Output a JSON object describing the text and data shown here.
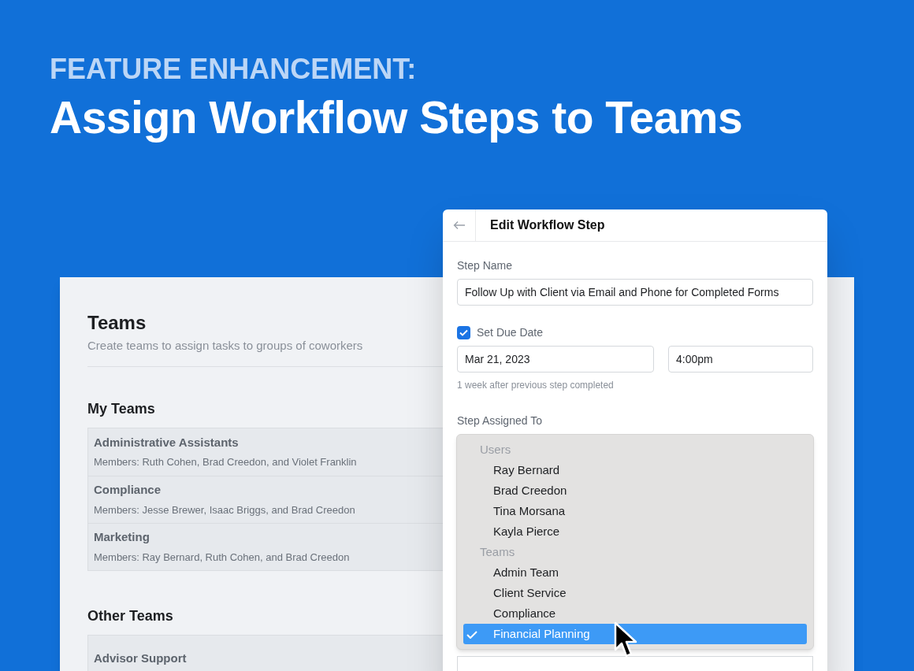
{
  "headline": {
    "eyebrow": "FEATURE ENHANCEMENT:",
    "title": "Assign Workflow Steps to Teams"
  },
  "teams_panel": {
    "title": "Teams",
    "subtitle": "Create teams to assign tasks to groups of coworkers",
    "sections": [
      {
        "heading": "My Teams",
        "teams": [
          {
            "name": "Administrative Assistants",
            "members": "Members: Ruth Cohen, Brad Creedon, and Violet Franklin"
          },
          {
            "name": "Compliance",
            "members": "Members: Jesse Brewer, Isaac Briggs, and Brad Creedon"
          },
          {
            "name": "Marketing",
            "members": "Members: Ray Bernard, Ruth Cohen, and Brad Creedon"
          }
        ]
      },
      {
        "heading": "Other Teams",
        "teams": [
          {
            "name": "Advisor Support"
          }
        ]
      }
    ]
  },
  "dialog": {
    "title": "Edit Workflow Step",
    "step_name": {
      "label": "Step Name",
      "value": "Follow Up with Client via Email and Phone for Completed Forms"
    },
    "due_date": {
      "label": "Set Due Date",
      "checked": true,
      "date": "Mar 21, 2023",
      "time": "4:00pm",
      "hint": "1 week after previous step completed"
    },
    "assigned": {
      "label": "Step Assigned To",
      "groups": [
        {
          "heading": "Users",
          "items": [
            {
              "label": "Ray Bernard",
              "selected": false
            },
            {
              "label": "Brad Creedon",
              "selected": false
            },
            {
              "label": "Tina Morsana",
              "selected": false
            },
            {
              "label": "Kayla Pierce",
              "selected": false
            }
          ]
        },
        {
          "heading": "Teams",
          "items": [
            {
              "label": "Admin Team",
              "selected": false
            },
            {
              "label": "Client Service",
              "selected": false
            },
            {
              "label": "Compliance",
              "selected": false
            },
            {
              "label": "Financial Planning",
              "selected": true
            }
          ]
        }
      ]
    }
  }
}
